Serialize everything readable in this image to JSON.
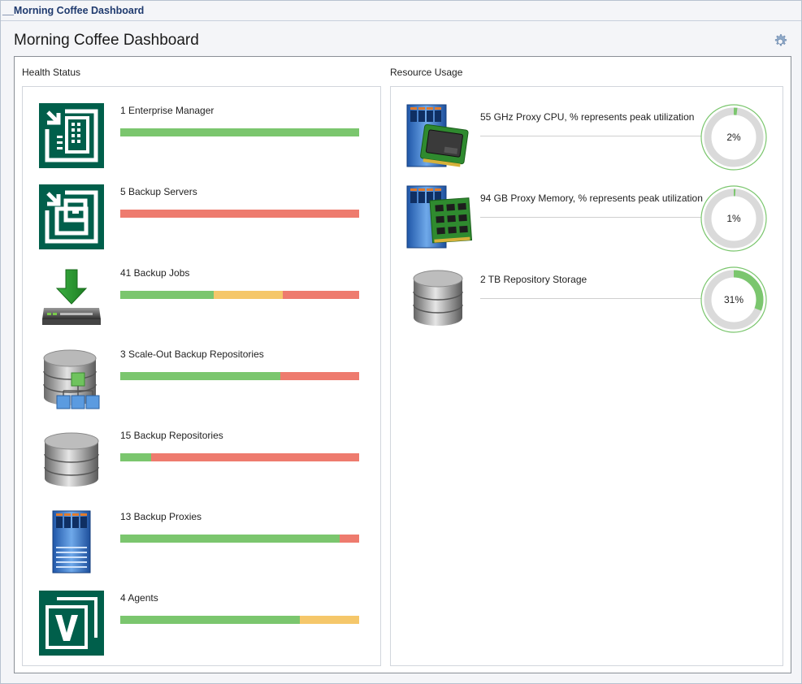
{
  "window": {
    "tab_title": "__Morning Coffee Dashboard"
  },
  "header": {
    "title": "Morning Coffee Dashboard",
    "settings_icon": "gear-icon"
  },
  "colors": {
    "ok": "#7bc66e",
    "warning": "#f5c76a",
    "error": "#ee7b6e",
    "track": "#dadada"
  },
  "health": {
    "label": "Health Status",
    "items": [
      {
        "label": "1 Enterprise Manager",
        "icon": "enterprise-manager-icon",
        "ok": 100,
        "warning": 0,
        "error": 0
      },
      {
        "label": "5 Backup Servers",
        "icon": "backup-server-icon",
        "ok": 0,
        "warning": 0,
        "error": 100
      },
      {
        "label": "41 Backup Jobs",
        "icon": "backup-job-icon",
        "ok": 39,
        "warning": 29,
        "error": 32
      },
      {
        "label": "3 Scale-Out Backup Repositories",
        "icon": "scale-out-repository-icon",
        "ok": 67,
        "warning": 0,
        "error": 33
      },
      {
        "label": "15 Backup Repositories",
        "icon": "backup-repository-icon",
        "ok": 13,
        "warning": 0,
        "error": 87
      },
      {
        "label": "13 Backup Proxies",
        "icon": "backup-proxy-icon",
        "ok": 92,
        "warning": 0,
        "error": 8
      },
      {
        "label": "4 Agents",
        "icon": "agent-icon",
        "ok": 75,
        "warning": 25,
        "error": 0
      }
    ]
  },
  "resources": {
    "label": "Resource Usage",
    "items": [
      {
        "label": "55 GHz Proxy CPU, % represents peak utilization",
        "icon": "proxy-cpu-icon",
        "percent": 2,
        "percent_text": "2%"
      },
      {
        "label": "94 GB Proxy Memory, % represents peak utilization",
        "icon": "proxy-memory-icon",
        "percent": 1,
        "percent_text": "1%"
      },
      {
        "label": "2 TB Repository Storage",
        "icon": "repository-storage-icon",
        "percent": 31,
        "percent_text": "31%"
      }
    ]
  }
}
